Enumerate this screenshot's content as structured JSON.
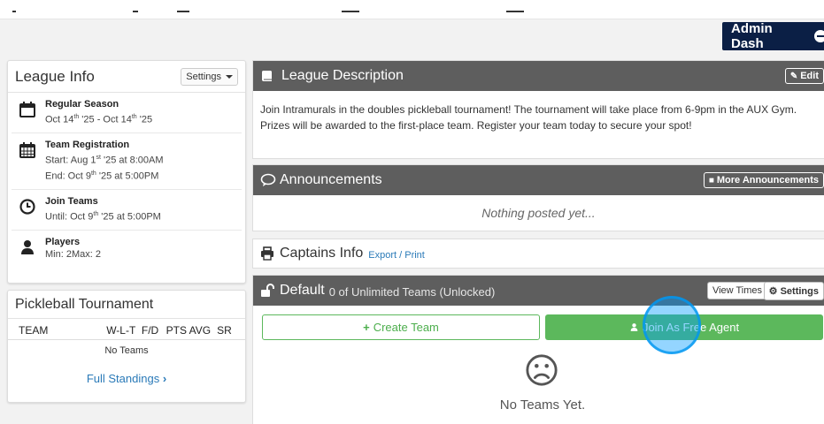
{
  "header": {
    "admin_label": "Admin Dash"
  },
  "league_info": {
    "title": "League Info",
    "settings_label": "Settings",
    "items": [
      {
        "title": "Regular Season",
        "line1": "Oct 14th '25 - Oct 14th '25",
        "icon": "calendar-icon"
      },
      {
        "title": "Team Registration",
        "line1": "Start: Aug 1st '25 at 8:00AM",
        "line2": "End: Oct 9th '25 at 5:00PM",
        "icon": "calendar-grid-icon"
      },
      {
        "title": "Join Teams",
        "line1": "Until: Oct 9th '25 at 5:00PM",
        "icon": "clock-icon"
      },
      {
        "title": "Players",
        "line1": "Min: 2Max: 2",
        "icon": "user-icon"
      }
    ]
  },
  "standings": {
    "title": "Pickleball Tournament",
    "columns": [
      "TEAM",
      "W-L-T",
      "F/D",
      "PTS AVG",
      "SR"
    ],
    "empty_text": "No Teams",
    "full_link": "Full Standings"
  },
  "description": {
    "title": "League Description",
    "edit_label": "Edit",
    "text": "Join Intramurals in the doubles pickleball tournament! The tournament will take place from 6-9pm in the AUX Gym. Prizes will be awarded to the first-place team. Register your team today to secure your spot!"
  },
  "announcements": {
    "title": "Announcements",
    "more_label": "More Announcements",
    "empty_text": "Nothing posted yet..."
  },
  "captains": {
    "title": "Captains Info",
    "link": "Export / Print"
  },
  "division": {
    "title": "Default",
    "subtitle": "0 of Unlimited Teams (Unlocked)",
    "view_times": "View Times",
    "settings_label": "Settings",
    "create_label": "Create Team",
    "agent_label": "Join As Free Agent",
    "no_teams": "No Teams Yet."
  }
}
